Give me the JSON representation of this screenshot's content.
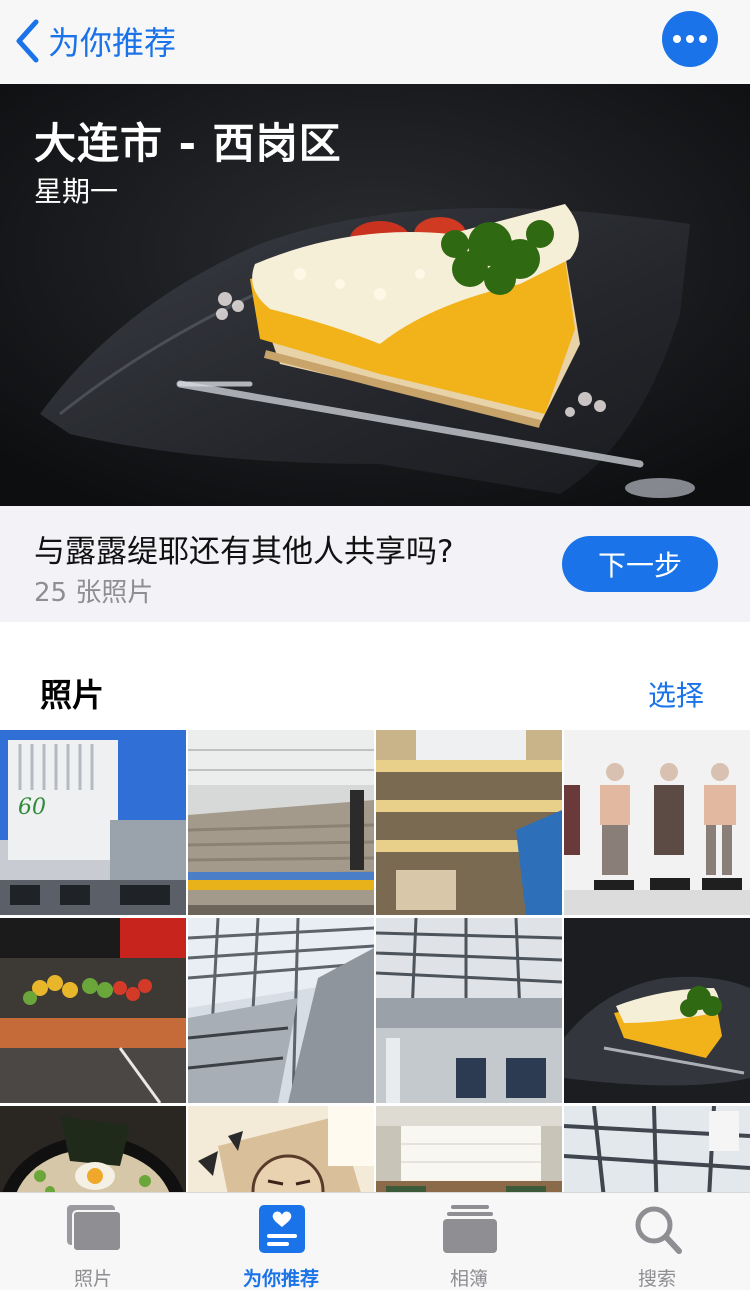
{
  "nav": {
    "back_label": "为你推荐",
    "back_icon": "chevron-left-icon",
    "more_icon": "ellipsis-icon",
    "accent_color": "#1a73e8"
  },
  "hero": {
    "title": "大连市 - 西岗区",
    "subtitle": "星期一"
  },
  "share": {
    "question": "与露露缇耶还有其他人共享吗?",
    "count": "25 张照片",
    "next_label": "下一步"
  },
  "photos": {
    "section_title": "照片",
    "select_label": "选择",
    "thumbnails": [
      "mall-exterior",
      "atrium-stairs",
      "atrium-floors",
      "fashion-mannequins",
      "produce-market",
      "glass-roof",
      "glass-roof",
      "dessert",
      "ramen",
      "comic",
      "ceiling-lights",
      "glass-roof"
    ]
  },
  "tabbar": {
    "active": "为你推荐",
    "tabs": [
      {
        "label": "照片",
        "icon": "photos-icon"
      },
      {
        "label": "为你推荐",
        "icon": "for-you-icon"
      },
      {
        "label": "相簿",
        "icon": "albums-icon"
      },
      {
        "label": "搜索",
        "icon": "search-icon"
      }
    ]
  }
}
